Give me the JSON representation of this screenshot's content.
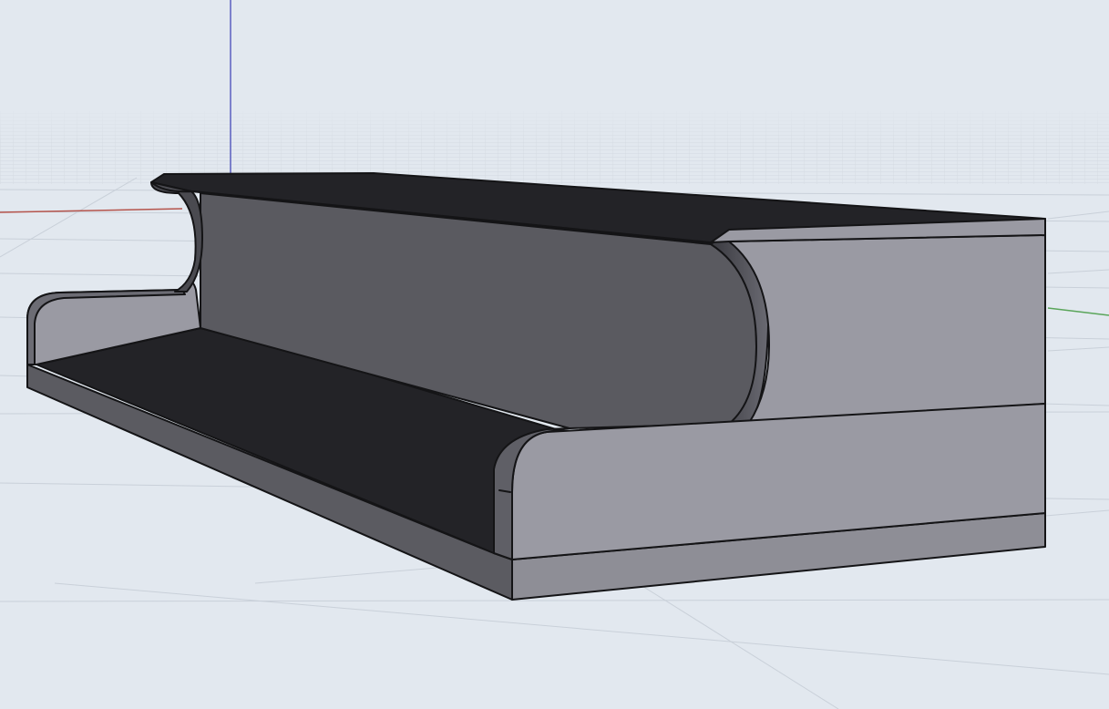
{
  "viewport": {
    "projection": "perspective",
    "display_mode": "shaded",
    "background_color": "#e2e8ef",
    "grid_visible": true,
    "grid_color": "#c9d0d9",
    "axes": {
      "x_color": "#b5544c",
      "y_color": "#5aa55a",
      "z_color": "#5a5fc0"
    }
  },
  "model": {
    "object_type": "solid",
    "description_hidden": "",
    "colors": {
      "dark_face": "#232327",
      "mid_face": "#5a5a60",
      "light_face": "#9a9aa3",
      "base_face": "#8e8e96",
      "edge": "#141416"
    }
  }
}
